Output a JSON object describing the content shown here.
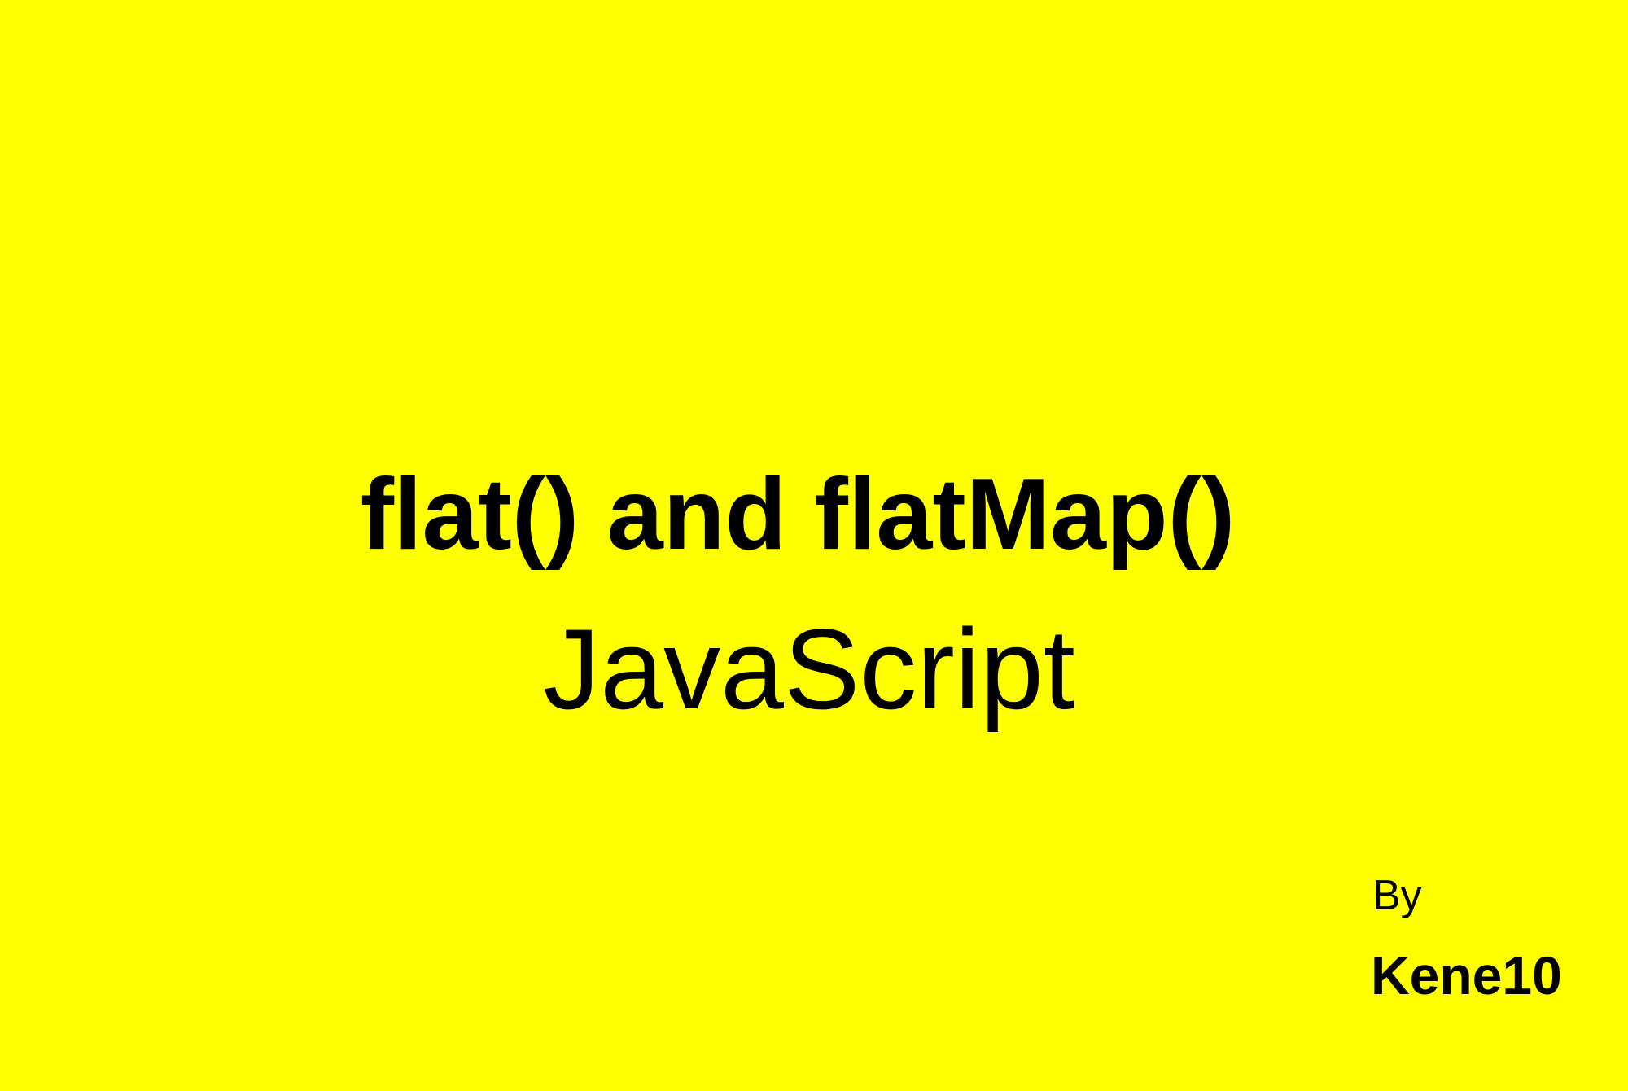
{
  "colors": {
    "background": "#ffff00",
    "text": "#000000"
  },
  "cover": {
    "title": "flat() and flatMap()",
    "subtitle": "JavaScript",
    "byline_label": "By",
    "author": "Kene10"
  }
}
